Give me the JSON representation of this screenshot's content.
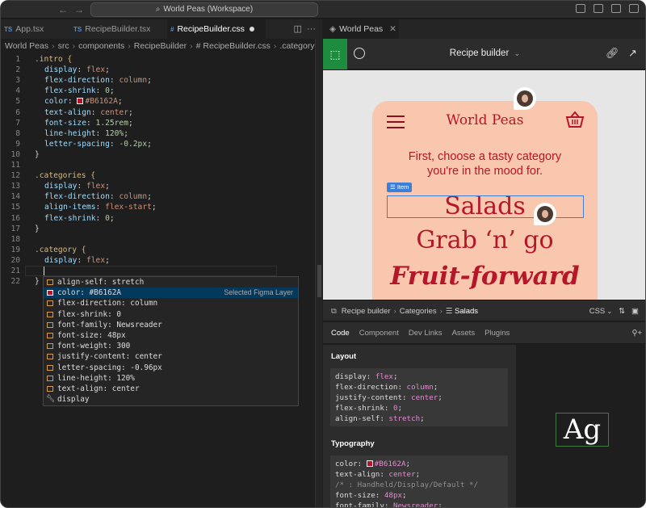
{
  "titlebar": {
    "workspace": "World Peas (Workspace)"
  },
  "tabs": [
    {
      "lang": "TS",
      "label": "App.tsx"
    },
    {
      "lang": "TS",
      "label": "RecipeBuilder.tsx"
    },
    {
      "lang": "#",
      "label": "RecipeBuilder.css"
    }
  ],
  "breadcrumb": [
    "World Peas",
    "src",
    "components",
    "RecipeBuilder",
    "# RecipeBuilder.css",
    ".category"
  ],
  "editor": {
    "lines": [
      {
        "n": "1",
        "sel": ".intro {"
      },
      {
        "n": "2",
        "p": "display",
        "v": "flex"
      },
      {
        "n": "3",
        "p": "flex-direction",
        "v": "column"
      },
      {
        "n": "4",
        "p": "flex-shrink",
        "v": "0"
      },
      {
        "n": "5",
        "p": "color",
        "v": "#B6162A"
      },
      {
        "n": "6",
        "p": "text-align",
        "v": "center"
      },
      {
        "n": "7",
        "p": "font-size",
        "v": "1.25rem"
      },
      {
        "n": "8",
        "p": "line-height",
        "v": "120%"
      },
      {
        "n": "9",
        "p": "letter-spacing",
        "v": "-0.2px"
      },
      {
        "n": "10",
        "sel": "}"
      },
      {
        "n": "11"
      },
      {
        "n": "12",
        "sel": ".categories {"
      },
      {
        "n": "13",
        "p": "display",
        "v": "flex"
      },
      {
        "n": "14",
        "p": "flex-direction",
        "v": "column"
      },
      {
        "n": "15",
        "p": "align-items",
        "v": "flex-start"
      },
      {
        "n": "16",
        "p": "flex-shrink",
        "v": "0"
      },
      {
        "n": "17",
        "sel": "}"
      },
      {
        "n": "18"
      },
      {
        "n": "19",
        "sel": ".category {"
      },
      {
        "n": "20",
        "p": "display",
        "v": "flex"
      },
      {
        "n": "21"
      },
      {
        "n": "22",
        "sel": "}"
      }
    ]
  },
  "suggest": {
    "items": [
      "align-self: stretch",
      "color: #B6162A",
      "flex-direction: column",
      "flex-shrink: 0",
      "font-family: Newsreader",
      "font-size: 48px",
      "font-weight: 300",
      "justify-content: center",
      "letter-spacing: -0.96px",
      "line-height: 120%",
      "text-align: center",
      "display"
    ],
    "hint": "Selected Figma Layer"
  },
  "figma": {
    "tab": "World Peas",
    "title": "Recipe builder",
    "brand": "World Peas",
    "tagline_1": "First, choose a tasty category",
    "tagline_2": "you're in the mood for.",
    "categories": [
      "Salads",
      "Grab ‘n’ go",
      "Fruit-forward"
    ],
    "selection_label": "Item",
    "accent": "#B6162A",
    "phone_bg": "#F9C7AE"
  },
  "inspector": {
    "breadcrumb": [
      "Recipe builder",
      "Categories",
      "Salads"
    ],
    "lang": "CSS",
    "tabs": [
      "Code",
      "Component",
      "Dev Links",
      "Assets",
      "Plugins"
    ],
    "layout_heading": "Layout",
    "layout": [
      {
        "p": "display",
        "v": "flex"
      },
      {
        "p": "flex-direction",
        "v": "column"
      },
      {
        "p": "justify-content",
        "v": "center"
      },
      {
        "p": "flex-shrink",
        "v": "0"
      },
      {
        "p": "align-self",
        "v": "stretch"
      }
    ],
    "typography_heading": "Typography",
    "typography": [
      {
        "p": "color",
        "v": "#B6162A"
      },
      {
        "p": "text-align",
        "v": "center"
      },
      {
        "comment": "/* : Handheld/Display/Default */"
      },
      {
        "p": "font-size",
        "v": "48px"
      },
      {
        "p": "font-family",
        "v": "Newsreader"
      }
    ],
    "preview": "Ag"
  }
}
